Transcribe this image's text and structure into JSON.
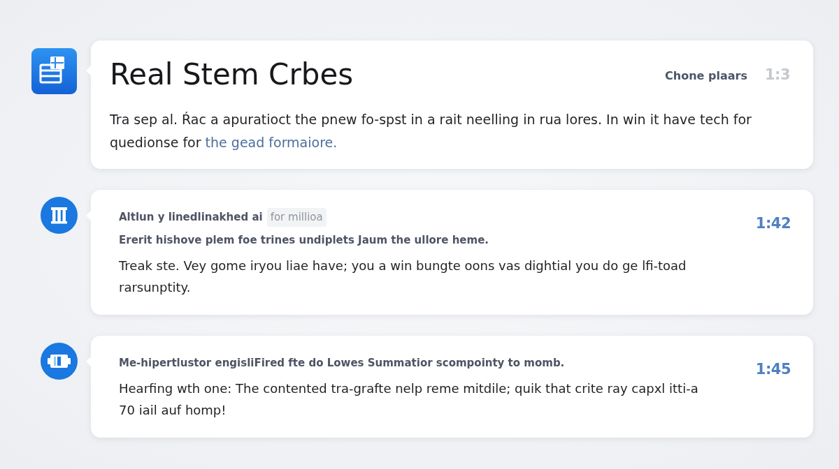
{
  "messages": [
    {
      "kind": "header",
      "title": "Real Stem Crbes",
      "tag": "Chone plaars",
      "time": {
        "text": "1:3",
        "color": "#c5c8cc"
      },
      "body": {
        "text": "Tra sep al. Ŕac a apuratioct the pnew fo-spst in a rait neelling in rua lores. In win it have tech for quedionse for",
        "link": "the gead formaiore."
      }
    },
    {
      "kind": "note",
      "lines": [
        {
          "text": "Altlun y linedlinakhed ai",
          "chip": "for millioa"
        },
        {
          "text": "Ererit hishove plem foe trines undiplets Jaum the ullore heme."
        }
      ],
      "time": {
        "text": "1:42",
        "color": "#4f80c2"
      },
      "body": {
        "text": "Treak ste. Vey gome iryou liae have; you a win bungte oons vas dightial you do ge lfi-toad rarsunptity."
      }
    },
    {
      "kind": "note",
      "lines": [
        {
          "text": "Me-hipertlustor engisliFired fte do Lowes Summatior scompointy to momb."
        }
      ],
      "time": {
        "text": "1:45",
        "color": "#4f80c2"
      },
      "body": {
        "text": "Hearfing wth one: The contented tra-grafte nelp reme mitdile; quik that crite ray capxl itti-a 70 iail auf homp!"
      }
    }
  ]
}
